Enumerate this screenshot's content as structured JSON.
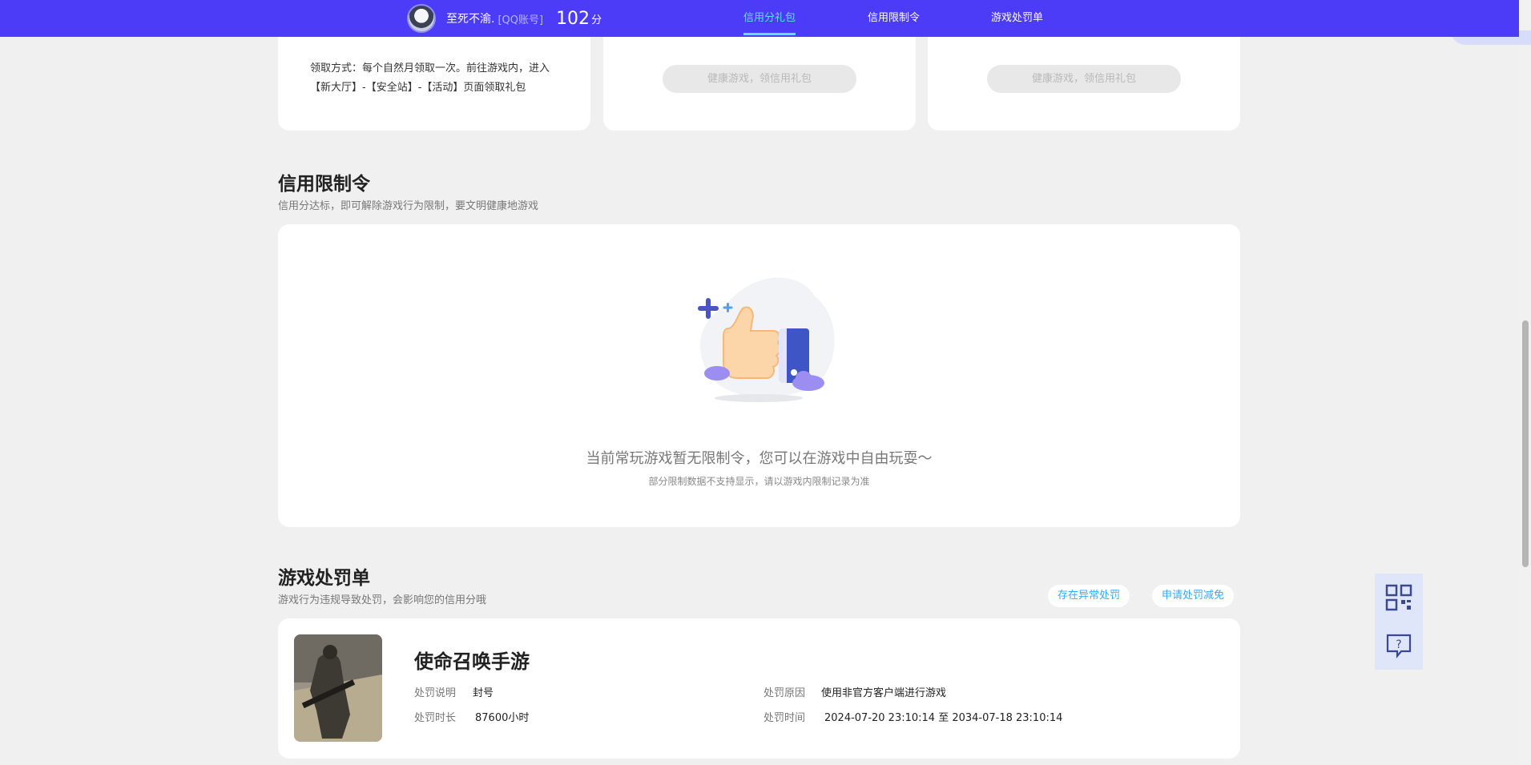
{
  "header": {
    "nickname": "至死不渝.",
    "account": "[QQ账号]",
    "score": "102",
    "score_unit": "分",
    "tabs": [
      {
        "label": "信用分礼包",
        "active": true
      },
      {
        "label": "信用限制令",
        "active": false
      },
      {
        "label": "游戏处罚单",
        "active": false
      }
    ]
  },
  "gift": {
    "claim_text": "领取方式：每个自然月领取一次。前往游戏内，进入【新大厅】-【安全站】-【活动】页面领取礼包",
    "button_label": "健康游戏，领信用礼包"
  },
  "restriction": {
    "title": "信用限制令",
    "subtitle": "信用分达标，即可解除游戏行为限制，要文明健康地游戏",
    "empty_main": "当前常玩游戏暂无限制令，您可以在游戏中自由玩耍～",
    "empty_sub": "部分限制数据不支持显示，请以游戏内限制记录为准"
  },
  "penalty": {
    "title": "游戏处罚单",
    "subtitle": "游戏行为违规导致处罚，会影响您的信用分哦",
    "btn_abnormal": "存在异常处罚",
    "btn_appeal": "申请处罚减免",
    "game_name": "使命召唤手游",
    "desc_label": "处罚说明",
    "desc_value": "封号",
    "duration_label": "处罚时长",
    "duration_value": "87600小时",
    "reason_label": "处罚原因",
    "reason_value": "使用非官方客户端进行游戏",
    "time_label": "处罚时间",
    "time_value": "2024-07-20 23:10:14 至 2034-07-18 23:10:14"
  },
  "colors": {
    "header_bg": "#4c3cf7",
    "active_tab": "#5fe0ff",
    "link_blue": "#3aa8ef"
  },
  "icons": {
    "qr": "qr-code-icon",
    "help": "help-chat-icon"
  }
}
